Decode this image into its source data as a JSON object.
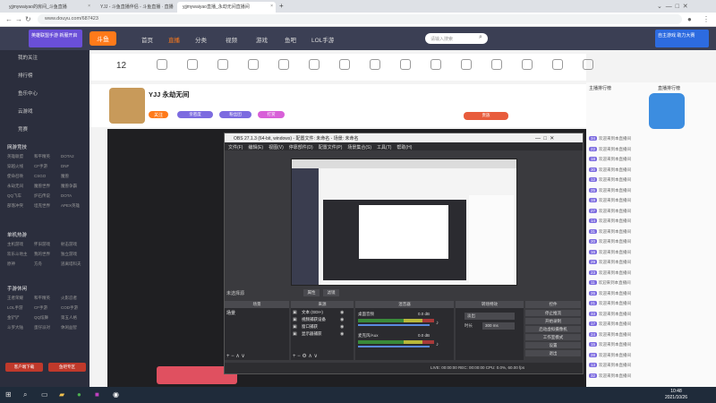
{
  "browser": {
    "tabs": [
      {
        "label": "yjjmywaiyao的房间_斗鱼直播"
      },
      {
        "label": "YJJ - 斗鱼直播伴侣 - 斗鱼直播 · 直播"
      },
      {
        "label": "yjjmywaiyao直播_永劫无间直播间"
      }
    ],
    "url": "www.douyu.com/687423",
    "new_tab": "+"
  },
  "site": {
    "logo": "斗鱼",
    "nav": [
      "首页",
      "直播",
      "分类",
      "视频",
      "游戏",
      "鱼吧",
      "LOL手游"
    ],
    "search_placeholder": "请输入搜索",
    "banner_left": "英雄联盟手游 新服开启",
    "banner_right": "自主游戏 助力大赛"
  },
  "sidebar": {
    "items": [
      "我的关注",
      "排行榜",
      "鱼乐中心",
      "云游戏",
      "竞赛"
    ],
    "section1": "网游竞技",
    "section1_cells": [
      "英雄联盟",
      "和平精英",
      "DOTA2",
      "穿越火线",
      "CF手游",
      "DNF",
      "使命召唤",
      "CSGO",
      "魔兽",
      "永劫无间",
      "魔兽世界",
      "魔兽争霸",
      "QQ飞车",
      "炉石传说",
      "DOTA",
      "部落冲突",
      "坦克世界",
      "APEX英雄"
    ],
    "section2": "单机热游",
    "section2_cells": [
      "主机游戏",
      "怀旧游戏",
      "射击游戏",
      "欢乐斗地主",
      "我的世界",
      "独立游戏",
      "原神",
      "方舟",
      "逃离塔科夫"
    ],
    "section3": "手游休闲",
    "section3_cells": [
      "王者荣耀",
      "和平精英",
      "火影忍者",
      "LOL手游",
      "CF手游",
      "COD手游",
      "金铲铲",
      "QQ炫舞",
      "第五人格",
      "斗罗大陆",
      "蛋仔派对",
      "休闲益智"
    ],
    "bottom_buttons": [
      "客户端下载",
      "鱼吧专区"
    ]
  },
  "streamer": {
    "level": "12",
    "name": "YJJ 永劫无间",
    "room_id": "687423",
    "follow": "关注",
    "tags": [
      "亲密度",
      "粉丝团",
      "打赏",
      "贵族"
    ]
  },
  "obs": {
    "title": "OBS 27.1.3 (64-bit, windows) - 配置文件: 未命名 - 场景: 未命名",
    "menu": [
      "文件(F)",
      "编辑(E)",
      "视图(V)",
      "停靠部件(D)",
      "配置文件(P)",
      "场景集合(S)",
      "工具(T)",
      "帮助(H)"
    ],
    "no_source": "未选择源",
    "prop_btn": "属性",
    "filter_btn": "滤镜",
    "docks": [
      "场景",
      "来源",
      "混音器",
      "转场特效",
      "控件"
    ],
    "scenes": [
      "场景"
    ],
    "sources": [
      "文本 (GDI+)",
      "视频捕获设备",
      "窗口捕获",
      "显示器捕获"
    ],
    "mixer": [
      {
        "name": "桌面音频",
        "db": "0.0 dB"
      },
      {
        "name": "麦克风/Aux",
        "db": "0.0 dB"
      }
    ],
    "transition": "淡出",
    "duration_label": "时长",
    "duration": "300 ms",
    "controls": [
      "停止推流",
      "开始录制",
      "启动虚拟摄像机",
      "工作室模式",
      "设置",
      "退出"
    ],
    "status": "LIVE: 00:00:00   REC: 00:00:00   CPU: 0.0%, 60.00 fps"
  },
  "chat": {
    "header": "主播排行榜",
    "tab2": "直播排行榜",
    "lines": [
      {
        "lv": "34",
        "text": "欢迎来到本直播间"
      },
      {
        "lv": "22",
        "text": "欢迎来到本直播间"
      },
      {
        "lv": "18",
        "text": "欢迎来到本直播间"
      },
      {
        "lv": "30",
        "text": "欢迎来到本直播间"
      },
      {
        "lv": "12",
        "text": "欢迎来到本直播间"
      },
      {
        "lv": "25",
        "text": "欢迎来到本直播间"
      },
      {
        "lv": "19",
        "text": "欢迎来到本直播间"
      },
      {
        "lv": "27",
        "text": "欢迎来到本直播间"
      },
      {
        "lv": "14",
        "text": "欢迎来到本直播间"
      },
      {
        "lv": "31",
        "text": "欢迎来到本直播间"
      },
      {
        "lv": "20",
        "text": "欢迎来到本直播间"
      },
      {
        "lv": "16",
        "text": "欢迎来到本直播间"
      },
      {
        "lv": "29",
        "text": "欢迎来到本直播间"
      },
      {
        "lv": "23",
        "text": "欢迎来到本直播间"
      },
      {
        "lv": "11",
        "text": "欢迎来到本直播间"
      },
      {
        "lv": "26",
        "text": "欢迎来到本直播间"
      },
      {
        "lv": "21",
        "text": "欢迎来到本直播间"
      },
      {
        "lv": "33",
        "text": "欢迎来到本直播间"
      },
      {
        "lv": "17",
        "text": "欢迎来到本直播间"
      },
      {
        "lv": "24",
        "text": "欢迎来到本直播间"
      },
      {
        "lv": "15",
        "text": "欢迎来到本直播间"
      },
      {
        "lv": "28",
        "text": "欢迎来到本直播间"
      },
      {
        "lv": "13",
        "text": "欢迎来到本直播间"
      },
      {
        "lv": "32",
        "text": "欢迎来到本直播间"
      }
    ]
  },
  "taskbar": {
    "time": "10:48",
    "date": "2021/10/26"
  },
  "colors": {
    "accent": "#ff7a1a",
    "sidebar": "#2b2e3d",
    "obs_bg": "#3a3a3e"
  }
}
